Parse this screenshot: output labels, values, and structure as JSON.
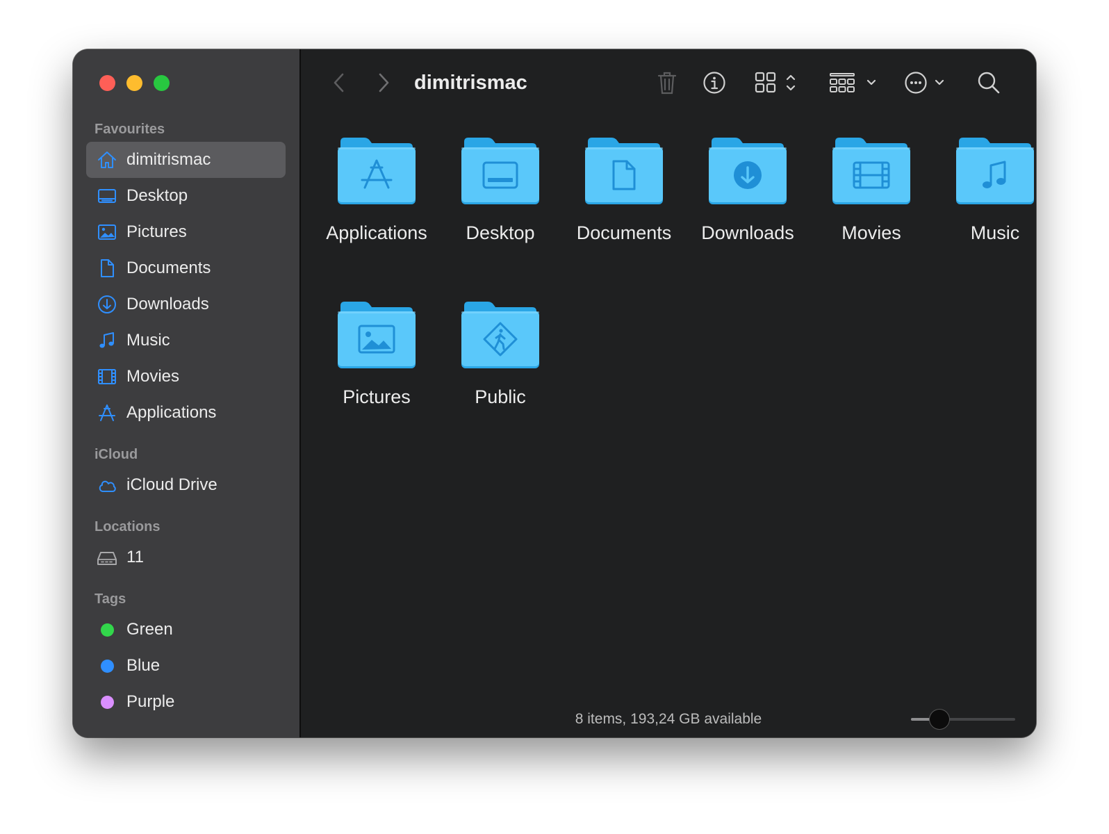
{
  "window": {
    "title": "dimitrismac"
  },
  "colors": {
    "accent": "#2f8fff",
    "folder_body": "#5ac8fa",
    "folder_tab": "#2aa6e6",
    "folder_glyph": "#1f8fd6",
    "sidebar_bg": "#3d3d3f",
    "main_bg": "#1f2021"
  },
  "sidebar": {
    "sections": [
      {
        "title": "Favourites",
        "items": [
          {
            "label": "dimitrismac",
            "icon": "home-icon",
            "selected": true
          },
          {
            "label": "Desktop",
            "icon": "desktop-icon"
          },
          {
            "label": "Pictures",
            "icon": "pictures-icon"
          },
          {
            "label": "Documents",
            "icon": "document-icon"
          },
          {
            "label": "Downloads",
            "icon": "download-icon"
          },
          {
            "label": "Music",
            "icon": "music-icon"
          },
          {
            "label": "Movies",
            "icon": "movies-icon"
          },
          {
            "label": "Applications",
            "icon": "applications-icon"
          }
        ]
      },
      {
        "title": "iCloud",
        "items": [
          {
            "label": "iCloud Drive",
            "icon": "cloud-icon"
          }
        ]
      },
      {
        "title": "Locations",
        "items": [
          {
            "label": "11",
            "icon": "drive-icon"
          }
        ]
      },
      {
        "title": "Tags",
        "items": [
          {
            "label": "Green",
            "tag_color": "#32d74b"
          },
          {
            "label": "Blue",
            "tag_color": "#2f8fff"
          },
          {
            "label": "Purple",
            "tag_color": "#da8fff"
          }
        ]
      }
    ]
  },
  "toolbar": {
    "back_icon": "chevron-left-icon",
    "forward_icon": "chevron-right-icon",
    "trash_icon": "trash-icon",
    "info_icon": "info-icon",
    "view_icon": "icon-grid-view-icon",
    "group_icon": "group-by-icon",
    "more_icon": "more-actions-icon",
    "search_icon": "search-icon"
  },
  "files": [
    {
      "label": "Applications",
      "glyph": "applications"
    },
    {
      "label": "Desktop",
      "glyph": "desktop"
    },
    {
      "label": "Documents",
      "glyph": "documents"
    },
    {
      "label": "Downloads",
      "glyph": "downloads"
    },
    {
      "label": "Movies",
      "glyph": "movies"
    },
    {
      "label": "Music",
      "glyph": "music"
    },
    {
      "label": "Pictures",
      "glyph": "pictures"
    },
    {
      "label": "Public",
      "glyph": "public"
    }
  ],
  "status": {
    "text": "8 items, 193,24 GB available"
  },
  "icon_size_slider": {
    "value_fraction": 0.27
  }
}
